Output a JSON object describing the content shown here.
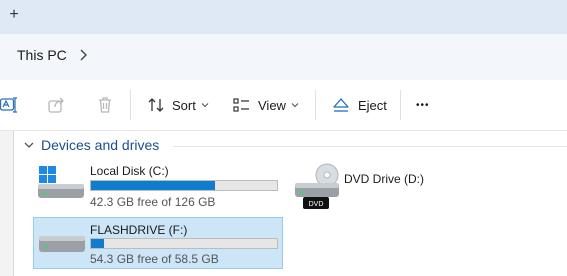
{
  "tabstrip": {
    "new_tab_glyph": "+"
  },
  "address": {
    "location": "This PC"
  },
  "toolbar": {
    "sort_label": "Sort",
    "view_label": "View",
    "eject_label": "Eject",
    "more_label": "•••"
  },
  "section": {
    "title": "Devices and drives"
  },
  "drives": [
    {
      "name": "Local Disk (C:)",
      "free_text": "42.3 GB free of 126 GB",
      "used_fraction": 0.664,
      "icon": "windows-drive-icon"
    },
    {
      "name": "DVD Drive (D:)",
      "badge": "DVD",
      "icon": "dvd-drive-icon"
    },
    {
      "name": "FLASHDRIVE (F:)",
      "free_text": "54.3 GB free of 58.5 GB",
      "used_fraction": 0.072,
      "icon": "usb-drive-icon",
      "selected": true
    }
  ],
  "colors": {
    "accent": "#0f7ccd",
    "selection": "#cde6f7",
    "section_title": "#1a4f8b",
    "tabstrip": "#dfe9f5"
  }
}
